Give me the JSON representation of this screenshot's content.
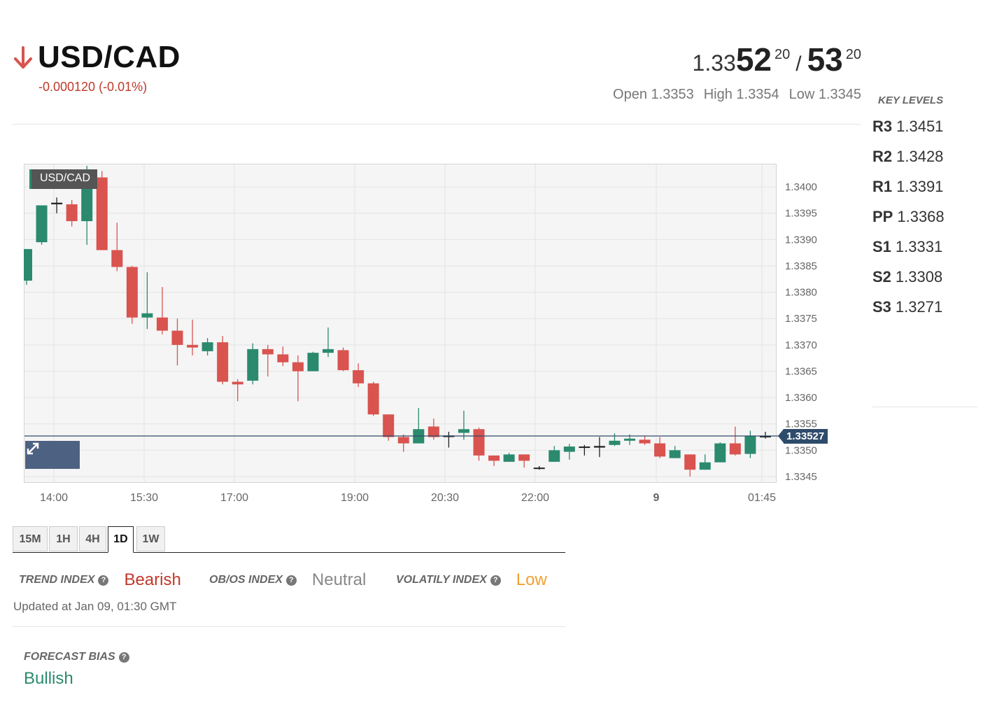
{
  "header": {
    "pair": "USD/CAD",
    "change": "-0.000120 (-0.01%)",
    "quote": {
      "bid_prefix": "1.33",
      "bid_big": "52",
      "bid_sup": "20",
      "slash": "/",
      "ask_big": "53",
      "ask_sup": "20"
    },
    "open": "Open 1.3353",
    "high": "High 1.3354",
    "low": "Low 1.3345"
  },
  "key_levels": {
    "title": "KEY LEVELS",
    "items": [
      {
        "name": "R3",
        "value": "1.3451"
      },
      {
        "name": "R2",
        "value": "1.3428"
      },
      {
        "name": "R1",
        "value": "1.3391"
      },
      {
        "name": "PP",
        "value": "1.3368"
      },
      {
        "name": "S1",
        "value": "1.3331"
      },
      {
        "name": "S2",
        "value": "1.3308"
      },
      {
        "name": "S3",
        "value": "1.3271"
      }
    ]
  },
  "chart": {
    "symbol_label": "USD/CAD",
    "current_price": "1.33527",
    "expand_icon": "expand-icon"
  },
  "chart_data": {
    "type": "candlestick",
    "x_labels": [
      "14:00",
      "15:30",
      "17:00",
      "19:00",
      "20:30",
      "22:00",
      "9",
      "01:45"
    ],
    "y_ticks": [
      "1.3345",
      "1.3350",
      "1.3355",
      "1.3360",
      "1.3365",
      "1.3370",
      "1.3375",
      "1.3380",
      "1.3385",
      "1.3390",
      "1.3395",
      "1.3400"
    ],
    "ylim": [
      1.33438,
      1.34044
    ],
    "current_price_value": 1.33527,
    "up_color": "#2b8a6e",
    "down_color": "#d9534f",
    "candles": [
      {
        "o": 1.33822,
        "h": 1.33862,
        "l": 1.33814,
        "c": 1.33882
      },
      {
        "o": 1.33895,
        "h": 1.3393,
        "l": 1.3389,
        "c": 1.33965
      },
      {
        "o": 1.33967,
        "h": 1.3398,
        "l": 1.3395,
        "c": 1.3397
      },
      {
        "o": 1.33967,
        "h": 1.33975,
        "l": 1.33925,
        "c": 1.33935
      },
      {
        "o": 1.33935,
        "h": 1.3404,
        "l": 1.3389,
        "c": 1.34018
      },
      {
        "o": 1.34018,
        "h": 1.3403,
        "l": 1.3388,
        "c": 1.3388
      },
      {
        "o": 1.3388,
        "h": 1.33932,
        "l": 1.3384,
        "c": 1.33848
      },
      {
        "o": 1.33848,
        "h": 1.3385,
        "l": 1.3374,
        "c": 1.33752
      },
      {
        "o": 1.33752,
        "h": 1.33838,
        "l": 1.3373,
        "c": 1.3376
      },
      {
        "o": 1.33752,
        "h": 1.3381,
        "l": 1.3372,
        "c": 1.33727
      },
      {
        "o": 1.33727,
        "h": 1.3375,
        "l": 1.33661,
        "c": 1.337
      },
      {
        "o": 1.337,
        "h": 1.33748,
        "l": 1.3368,
        "c": 1.33695
      },
      {
        "o": 1.33688,
        "h": 1.33713,
        "l": 1.3368,
        "c": 1.33705
      },
      {
        "o": 1.33705,
        "h": 1.33717,
        "l": 1.33625,
        "c": 1.3363
      },
      {
        "o": 1.3363,
        "h": 1.33635,
        "l": 1.33593,
        "c": 1.33625
      },
      {
        "o": 1.33632,
        "h": 1.33703,
        "l": 1.33625,
        "c": 1.33692
      },
      {
        "o": 1.33692,
        "h": 1.337,
        "l": 1.3364,
        "c": 1.33682
      },
      {
        "o": 1.33682,
        "h": 1.33697,
        "l": 1.3366,
        "c": 1.33667
      },
      {
        "o": 1.33667,
        "h": 1.3368,
        "l": 1.33593,
        "c": 1.3365
      },
      {
        "o": 1.3365,
        "h": 1.33687,
        "l": 1.3365,
        "c": 1.33685
      },
      {
        "o": 1.33685,
        "h": 1.33733,
        "l": 1.33677,
        "c": 1.33692
      },
      {
        "o": 1.3369,
        "h": 1.33695,
        "l": 1.3365,
        "c": 1.33652
      },
      {
        "o": 1.33652,
        "h": 1.33665,
        "l": 1.3362,
        "c": 1.33627
      },
      {
        "o": 1.33627,
        "h": 1.3363,
        "l": 1.33565,
        "c": 1.33568
      },
      {
        "o": 1.33568,
        "h": 1.33568,
        "l": 1.33518,
        "c": 1.33525
      },
      {
        "o": 1.33525,
        "h": 1.3353,
        "l": 1.33497,
        "c": 1.33513
      },
      {
        "o": 1.33513,
        "h": 1.3358,
        "l": 1.33513,
        "c": 1.3354
      },
      {
        "o": 1.33545,
        "h": 1.3356,
        "l": 1.3352,
        "c": 1.33525
      },
      {
        "o": 1.33525,
        "h": 1.33535,
        "l": 1.33505,
        "c": 1.33528
      },
      {
        "o": 1.33533,
        "h": 1.33575,
        "l": 1.3352,
        "c": 1.3354
      },
      {
        "o": 1.3354,
        "h": 1.33543,
        "l": 1.3348,
        "c": 1.3349
      },
      {
        "o": 1.3349,
        "h": 1.3349,
        "l": 1.3347,
        "c": 1.3348
      },
      {
        "o": 1.33478,
        "h": 1.33495,
        "l": 1.33478,
        "c": 1.33492
      },
      {
        "o": 1.33492,
        "h": 1.33492,
        "l": 1.33467,
        "c": 1.3348
      },
      {
        "o": 1.33467,
        "h": 1.3347,
        "l": 1.33463,
        "c": 1.33467
      },
      {
        "o": 1.33478,
        "h": 1.33508,
        "l": 1.33478,
        "c": 1.335
      },
      {
        "o": 1.33497,
        "h": 1.33512,
        "l": 1.33482,
        "c": 1.33507
      },
      {
        "o": 1.33507,
        "h": 1.3351,
        "l": 1.3349,
        "c": 1.33507
      },
      {
        "o": 1.33508,
        "h": 1.33525,
        "l": 1.33487,
        "c": 1.33505
      },
      {
        "o": 1.3351,
        "h": 1.33532,
        "l": 1.33508,
        "c": 1.33518
      },
      {
        "o": 1.33518,
        "h": 1.3353,
        "l": 1.3351,
        "c": 1.33522
      },
      {
        "o": 1.3352,
        "h": 1.33528,
        "l": 1.3351,
        "c": 1.33513
      },
      {
        "o": 1.33513,
        "h": 1.33525,
        "l": 1.33485,
        "c": 1.33488
      },
      {
        "o": 1.33485,
        "h": 1.33508,
        "l": 1.33485,
        "c": 1.335
      },
      {
        "o": 1.33492,
        "h": 1.33492,
        "l": 1.3345,
        "c": 1.33463
      },
      {
        "o": 1.33463,
        "h": 1.33492,
        "l": 1.33463,
        "c": 1.33477
      },
      {
        "o": 1.33477,
        "h": 1.33515,
        "l": 1.33477,
        "c": 1.33513
      },
      {
        "o": 1.33513,
        "h": 1.33545,
        "l": 1.3349,
        "c": 1.33492
      },
      {
        "o": 1.33493,
        "h": 1.33537,
        "l": 1.33485,
        "c": 1.33527
      },
      {
        "o": 1.33527,
        "h": 1.33535,
        "l": 1.33522,
        "c": 1.33527
      }
    ]
  },
  "timeframes": {
    "items": [
      "15M",
      "1H",
      "4H",
      "1D",
      "1W"
    ],
    "active": "1D"
  },
  "indexes": {
    "trend_label": "TREND INDEX",
    "trend_value": "Bearish",
    "trend_color": "#c0392b",
    "obos_label": "OB/OS INDEX",
    "obos_value": "Neutral",
    "obos_color": "#888888",
    "volatility_label": "VOLATILY INDEX",
    "volatility_value": "Low",
    "volatility_color": "#f0a030",
    "help_icon": "question-circle-icon",
    "updated": "Updated at Jan 09, 01:30 GMT"
  },
  "forecast": {
    "label": "FORECAST BIAS",
    "value": "Bullish"
  }
}
